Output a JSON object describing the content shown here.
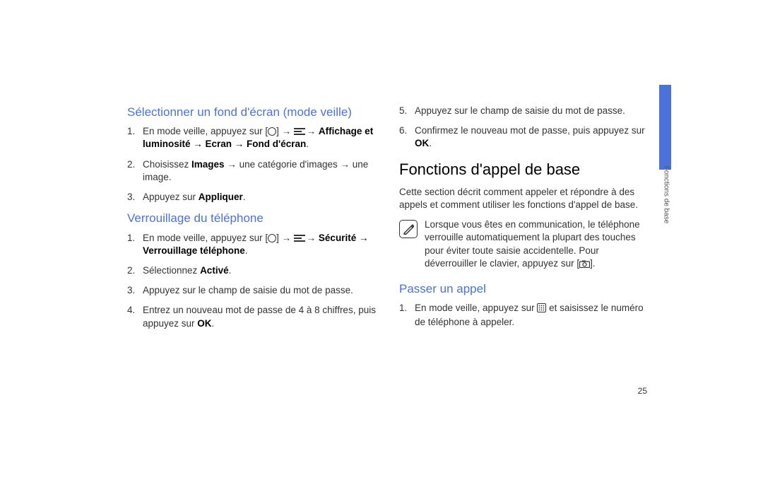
{
  "left": {
    "h1": "Sélectionner un fond d'écran (mode veille)",
    "list1": {
      "i1a": "En mode veille, appuyez sur [",
      "i1b": "] →",
      "i1c": "→",
      "i1d": "Affichage et luminosité → Ecran → Fond d'écran",
      "i1e": ".",
      "i2a": "Choisissez ",
      "i2b": "Images",
      "i2c": " → une catégorie d'images → une image.",
      "i3a": "Appuyez sur ",
      "i3b": "Appliquer",
      "i3c": "."
    },
    "h2": "Verrouillage du téléphone",
    "list2": {
      "i1a": "En mode veille, appuyez sur [",
      "i1b": "] →",
      "i1c": "→",
      "i1d": "Sécurité → Verrouillage téléphone",
      "i1e": ".",
      "i2a": "Sélectionnez ",
      "i2b": "Activé",
      "i2c": ".",
      "i3": "Appuyez sur le champ de saisie du mot de passe.",
      "i4a": "Entrez un nouveau mot de passe de 4 à 8 chiffres, puis appuyez sur ",
      "i4b": "OK",
      "i4c": "."
    }
  },
  "right": {
    "list_top": {
      "i5": "Appuyez sur le champ de saisie du mot de passe.",
      "i6a": "Confirmez le nouveau mot de passe, puis appuyez sur ",
      "i6b": "OK",
      "i6c": "."
    },
    "section_title": "Fonctions d'appel de base",
    "intro": "Cette section décrit comment appeler et répondre à des appels et comment utiliser les fonctions d'appel de base.",
    "note": "Lorsque vous êtes en communication, le téléphone verrouille automatiquement la plupart des touches pour éviter toute saisie accidentelle. Pour déverrouiller le clavier, appuyez sur [",
    "note_end": "].",
    "h3": "Passer un appel",
    "list_call": {
      "i1a": "En mode veille, appuyez sur ",
      "i1b": " et saisissez le numéro de téléphone à appeler."
    }
  },
  "tab_label": "Fonctions de base",
  "page_number": "25"
}
